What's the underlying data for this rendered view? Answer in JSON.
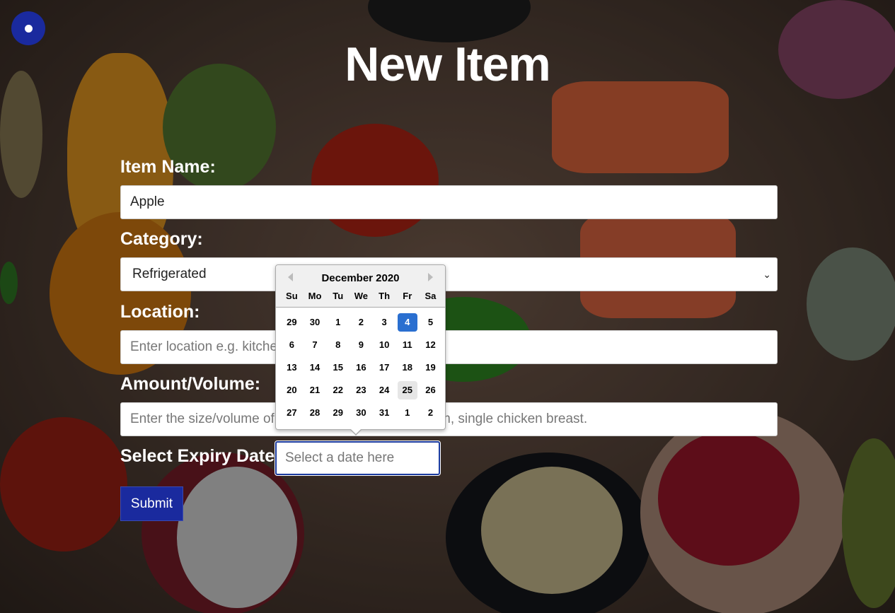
{
  "title": "New Item",
  "form": {
    "item_name_label": "Item Name:",
    "item_name_value": "Apple",
    "category_label": "Category:",
    "category_value": "Refrigerated",
    "location_label": "Location:",
    "location_placeholder_visible": "Enter location e.g. kitche",
    "amount_label": "Amount/Volume:",
    "amount_placeholder_left": "Enter the size/volume of",
    "amount_placeholder_right": "m, single chicken breast.",
    "expiry_label": "Select Expiry Date:",
    "expiry_placeholder": "Select a date here",
    "submit_label": "Submit"
  },
  "datepicker": {
    "month_label": "December 2020",
    "weekdays": [
      "Su",
      "Mo",
      "Tu",
      "We",
      "Th",
      "Fr",
      "Sa"
    ],
    "weeks": [
      [
        "29",
        "30",
        "1",
        "2",
        "3",
        "4",
        "5"
      ],
      [
        "6",
        "7",
        "8",
        "9",
        "10",
        "11",
        "12"
      ],
      [
        "13",
        "14",
        "15",
        "16",
        "17",
        "18",
        "19"
      ],
      [
        "20",
        "21",
        "22",
        "23",
        "24",
        "25",
        "26"
      ],
      [
        "27",
        "28",
        "29",
        "30",
        "31",
        "1",
        "2"
      ]
    ],
    "selected_day": "4",
    "today_day": "25"
  },
  "colors": {
    "accent": "#1a2a9e",
    "selected_day": "#2a6fd0"
  },
  "icons": {
    "menu": "menu-dot-icon",
    "prev": "chevron-left-icon",
    "next": "chevron-right-icon",
    "select": "chevron-down-icon"
  }
}
